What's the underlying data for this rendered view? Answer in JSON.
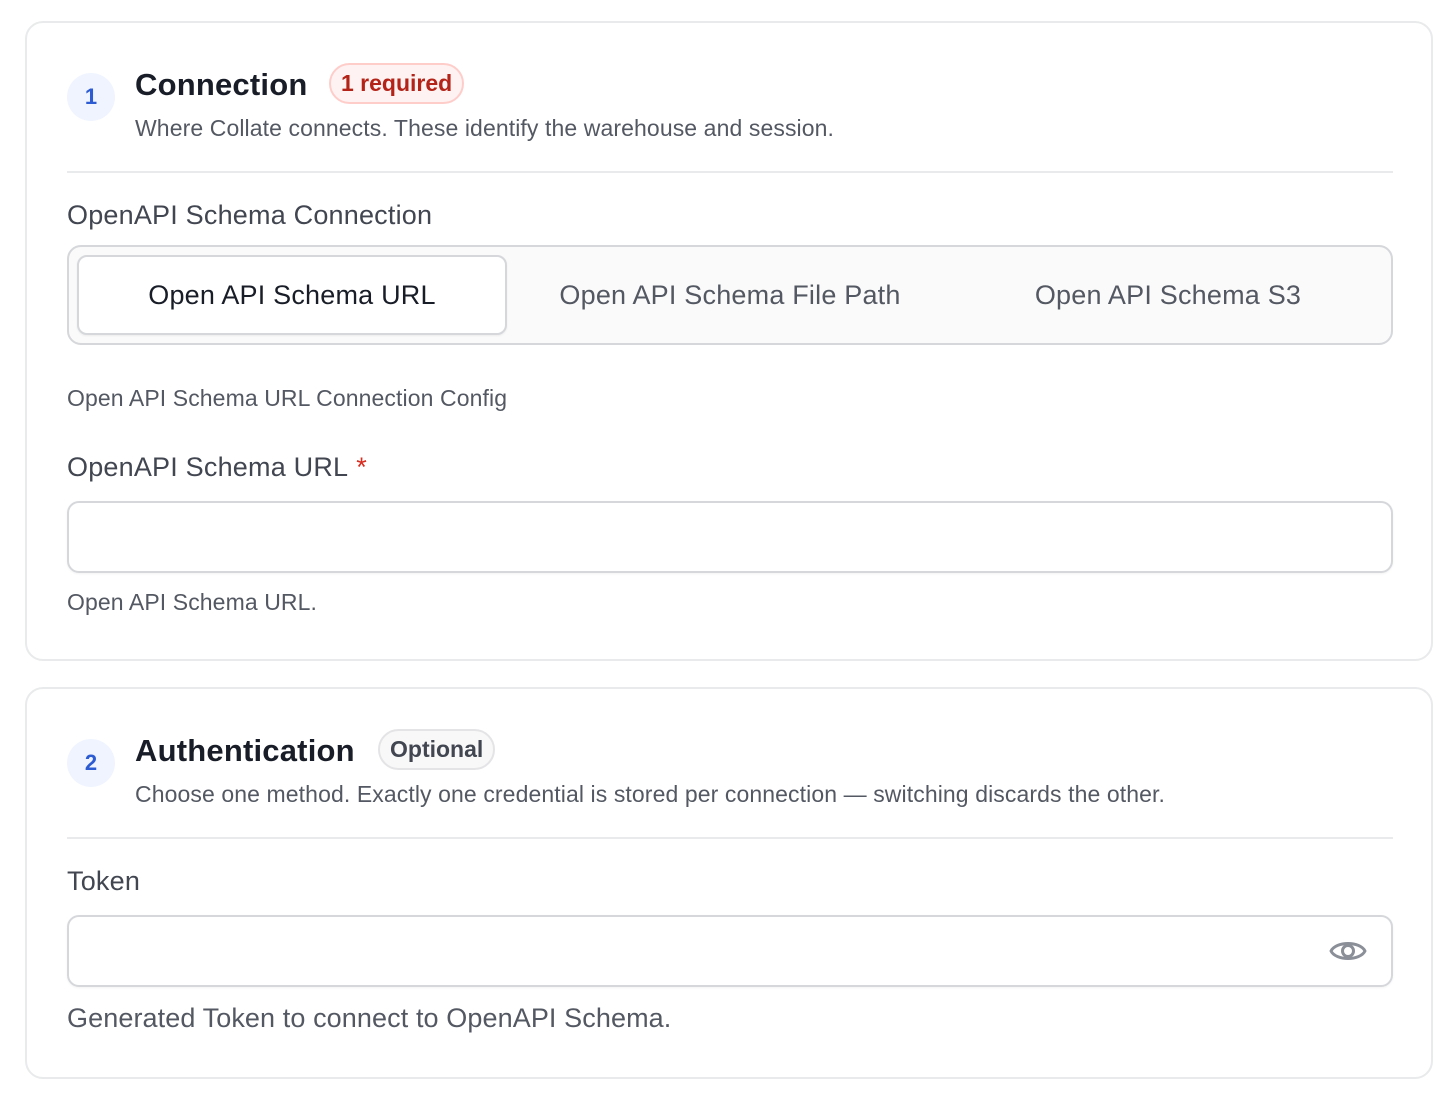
{
  "connection": {
    "step": "1",
    "title": "Connection",
    "badge": "1 required",
    "description": "Where Collate connects. These identify the warehouse and session.",
    "schema_connection_label": "OpenAPI Schema Connection",
    "options": [
      {
        "label": "Open API Schema URL",
        "selected": true
      },
      {
        "label": "Open API Schema File Path",
        "selected": false
      },
      {
        "label": "Open API Schema S3",
        "selected": false
      }
    ],
    "config_caption": "Open API Schema URL Connection Config",
    "url_field": {
      "label": "OpenAPI Schema URL",
      "required_mark": "*",
      "value": "",
      "hint": "Open API Schema URL."
    }
  },
  "authentication": {
    "step": "2",
    "title": "Authentication",
    "badge": "Optional",
    "description": "Choose one method. Exactly one credential is stored per connection — switching discards the other.",
    "token_field": {
      "label": "Token",
      "value": "",
      "hint": "Generated Token to connect to OpenAPI Schema.",
      "toggle_icon": "eye-icon"
    }
  },
  "colors": {
    "accent": "#2d5bd1",
    "required_text": "#b42318",
    "required_bg": "#fef3f2",
    "border": "#d5d7da"
  }
}
